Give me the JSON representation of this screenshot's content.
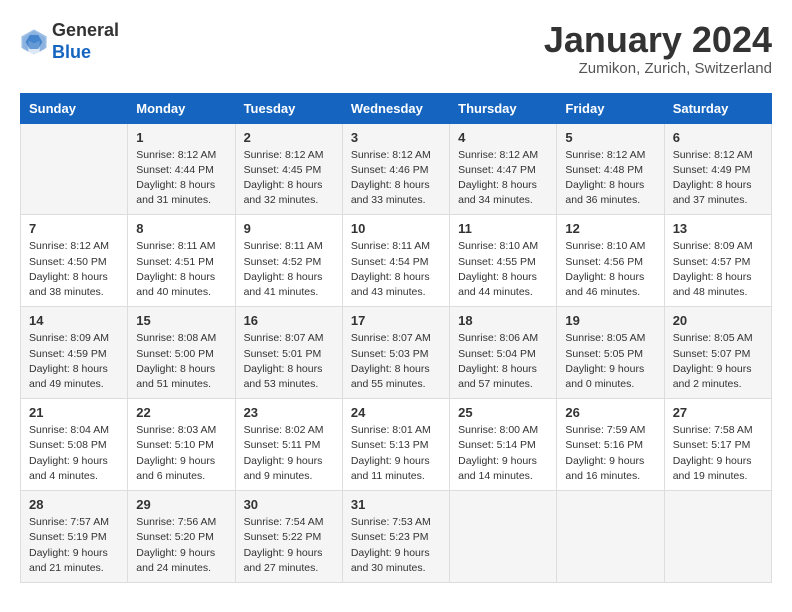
{
  "header": {
    "logo_line1": "General",
    "logo_line2": "Blue",
    "month_title": "January 2024",
    "location": "Zumikon, Zurich, Switzerland"
  },
  "days_of_week": [
    "Sunday",
    "Monday",
    "Tuesday",
    "Wednesday",
    "Thursday",
    "Friday",
    "Saturday"
  ],
  "weeks": [
    [
      {
        "day": "",
        "sunrise": "",
        "sunset": "",
        "daylight": ""
      },
      {
        "day": "1",
        "sunrise": "8:12 AM",
        "sunset": "4:44 PM",
        "daylight": "8 hours and 31 minutes."
      },
      {
        "day": "2",
        "sunrise": "8:12 AM",
        "sunset": "4:45 PM",
        "daylight": "8 hours and 32 minutes."
      },
      {
        "day": "3",
        "sunrise": "8:12 AM",
        "sunset": "4:46 PM",
        "daylight": "8 hours and 33 minutes."
      },
      {
        "day": "4",
        "sunrise": "8:12 AM",
        "sunset": "4:47 PM",
        "daylight": "8 hours and 34 minutes."
      },
      {
        "day": "5",
        "sunrise": "8:12 AM",
        "sunset": "4:48 PM",
        "daylight": "8 hours and 36 minutes."
      },
      {
        "day": "6",
        "sunrise": "8:12 AM",
        "sunset": "4:49 PM",
        "daylight": "8 hours and 37 minutes."
      }
    ],
    [
      {
        "day": "7",
        "sunrise": "8:12 AM",
        "sunset": "4:50 PM",
        "daylight": "8 hours and 38 minutes."
      },
      {
        "day": "8",
        "sunrise": "8:11 AM",
        "sunset": "4:51 PM",
        "daylight": "8 hours and 40 minutes."
      },
      {
        "day": "9",
        "sunrise": "8:11 AM",
        "sunset": "4:52 PM",
        "daylight": "8 hours and 41 minutes."
      },
      {
        "day": "10",
        "sunrise": "8:11 AM",
        "sunset": "4:54 PM",
        "daylight": "8 hours and 43 minutes."
      },
      {
        "day": "11",
        "sunrise": "8:10 AM",
        "sunset": "4:55 PM",
        "daylight": "8 hours and 44 minutes."
      },
      {
        "day": "12",
        "sunrise": "8:10 AM",
        "sunset": "4:56 PM",
        "daylight": "8 hours and 46 minutes."
      },
      {
        "day": "13",
        "sunrise": "8:09 AM",
        "sunset": "4:57 PM",
        "daylight": "8 hours and 48 minutes."
      }
    ],
    [
      {
        "day": "14",
        "sunrise": "8:09 AM",
        "sunset": "4:59 PM",
        "daylight": "8 hours and 49 minutes."
      },
      {
        "day": "15",
        "sunrise": "8:08 AM",
        "sunset": "5:00 PM",
        "daylight": "8 hours and 51 minutes."
      },
      {
        "day": "16",
        "sunrise": "8:07 AM",
        "sunset": "5:01 PM",
        "daylight": "8 hours and 53 minutes."
      },
      {
        "day": "17",
        "sunrise": "8:07 AM",
        "sunset": "5:03 PM",
        "daylight": "8 hours and 55 minutes."
      },
      {
        "day": "18",
        "sunrise": "8:06 AM",
        "sunset": "5:04 PM",
        "daylight": "8 hours and 57 minutes."
      },
      {
        "day": "19",
        "sunrise": "8:05 AM",
        "sunset": "5:05 PM",
        "daylight": "9 hours and 0 minutes."
      },
      {
        "day": "20",
        "sunrise": "8:05 AM",
        "sunset": "5:07 PM",
        "daylight": "9 hours and 2 minutes."
      }
    ],
    [
      {
        "day": "21",
        "sunrise": "8:04 AM",
        "sunset": "5:08 PM",
        "daylight": "9 hours and 4 minutes."
      },
      {
        "day": "22",
        "sunrise": "8:03 AM",
        "sunset": "5:10 PM",
        "daylight": "9 hours and 6 minutes."
      },
      {
        "day": "23",
        "sunrise": "8:02 AM",
        "sunset": "5:11 PM",
        "daylight": "9 hours and 9 minutes."
      },
      {
        "day": "24",
        "sunrise": "8:01 AM",
        "sunset": "5:13 PM",
        "daylight": "9 hours and 11 minutes."
      },
      {
        "day": "25",
        "sunrise": "8:00 AM",
        "sunset": "5:14 PM",
        "daylight": "9 hours and 14 minutes."
      },
      {
        "day": "26",
        "sunrise": "7:59 AM",
        "sunset": "5:16 PM",
        "daylight": "9 hours and 16 minutes."
      },
      {
        "day": "27",
        "sunrise": "7:58 AM",
        "sunset": "5:17 PM",
        "daylight": "9 hours and 19 minutes."
      }
    ],
    [
      {
        "day": "28",
        "sunrise": "7:57 AM",
        "sunset": "5:19 PM",
        "daylight": "9 hours and 21 minutes."
      },
      {
        "day": "29",
        "sunrise": "7:56 AM",
        "sunset": "5:20 PM",
        "daylight": "9 hours and 24 minutes."
      },
      {
        "day": "30",
        "sunrise": "7:54 AM",
        "sunset": "5:22 PM",
        "daylight": "9 hours and 27 minutes."
      },
      {
        "day": "31",
        "sunrise": "7:53 AM",
        "sunset": "5:23 PM",
        "daylight": "9 hours and 30 minutes."
      },
      {
        "day": "",
        "sunrise": "",
        "sunset": "",
        "daylight": ""
      },
      {
        "day": "",
        "sunrise": "",
        "sunset": "",
        "daylight": ""
      },
      {
        "day": "",
        "sunrise": "",
        "sunset": "",
        "daylight": ""
      }
    ]
  ]
}
